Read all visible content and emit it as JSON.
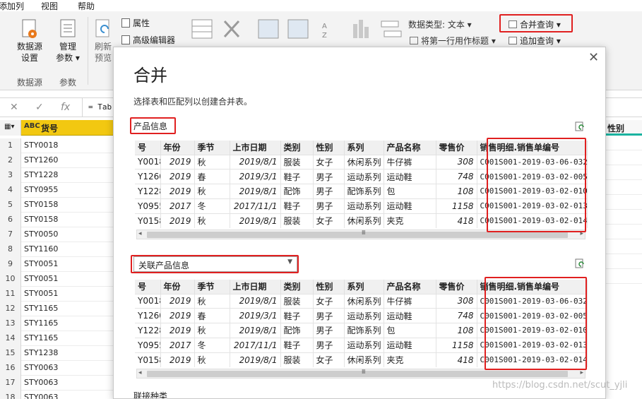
{
  "menu": [
    "添加列",
    "视图",
    "帮助"
  ],
  "ribbon": {
    "datasource_label": "数据源\n设置",
    "params_label": "管理\n参数 ▾",
    "refresh_label": "刷新\n预览",
    "properties": "属性",
    "advanced_editor": "高级编辑器",
    "group_datasource": "数据源",
    "group_params": "参数",
    "data_type": "数据类型: 文本 ▾",
    "first_row_header": "将第一行用作标题 ▾",
    "merge_queries": "合并查询 ▾",
    "append_queries": "追加查询 ▾"
  },
  "formula": {
    "fx": "fx",
    "text": "= Tab"
  },
  "sheet": {
    "column_type": "ABC",
    "column_name": "货号",
    "rows": [
      {
        "n": "1",
        "v": "STY0018"
      },
      {
        "n": "2",
        "v": "STY1260"
      },
      {
        "n": "3",
        "v": "STY1228"
      },
      {
        "n": "4",
        "v": "STY0955"
      },
      {
        "n": "5",
        "v": "STY0158"
      },
      {
        "n": "6",
        "v": "STY0158"
      },
      {
        "n": "7",
        "v": "STY0050"
      },
      {
        "n": "8",
        "v": "STY1160"
      },
      {
        "n": "9",
        "v": "STY0051"
      },
      {
        "n": "10",
        "v": "STY0051"
      },
      {
        "n": "11",
        "v": "STY0051"
      },
      {
        "n": "12",
        "v": "STY1165"
      },
      {
        "n": "13",
        "v": "STY1165"
      },
      {
        "n": "14",
        "v": "STY1165"
      },
      {
        "n": "15",
        "v": "STY1238"
      },
      {
        "n": "16",
        "v": "STY0063"
      },
      {
        "n": "17",
        "v": "STY0063"
      },
      {
        "n": "18",
        "v": "STY0063"
      }
    ],
    "right_header": "性别"
  },
  "dialog": {
    "title": "合并",
    "close": "✕",
    "description": "选择表和匹配列以创建合并表。",
    "table1_label": "产品信息",
    "table2_label": "关联产品信息",
    "join_kind_label": "联接种类",
    "columns": [
      "号",
      "年份",
      "季节",
      "上市日期",
      "类别",
      "性别",
      "系列",
      "产品名称",
      "零售价",
      "销售明细.销售单编号"
    ],
    "rows": [
      [
        "Y0018",
        "2019",
        "秋",
        "2019/8/1",
        "服装",
        "女子",
        "休闲系列",
        "牛仔裤",
        "308",
        "C001S001-2019-03-06-032"
      ],
      [
        "Y1260",
        "2019",
        "春",
        "2019/3/1",
        "鞋子",
        "男子",
        "运动系列",
        "运动鞋",
        "748",
        "C001S001-2019-03-02-005"
      ],
      [
        "Y1228",
        "2019",
        "秋",
        "2019/8/1",
        "配饰",
        "男子",
        "配饰系列",
        "包",
        "108",
        "C001S001-2019-03-02-010"
      ],
      [
        "Y0955",
        "2017",
        "冬",
        "2017/11/1",
        "鞋子",
        "男子",
        "运动系列",
        "运动鞋",
        "1158",
        "C001S001-2019-03-02-013"
      ],
      [
        "Y0158",
        "2019",
        "秋",
        "2019/8/1",
        "服装",
        "女子",
        "休闲系列",
        "夹克",
        "418",
        "C001S001-2019-03-02-014"
      ]
    ]
  },
  "watermark": "https://blog.csdn.net/scut_yjli",
  "colors": {
    "highlight": "#e02020",
    "column_header": "#f2c811",
    "accent": "#1ab3a0"
  }
}
